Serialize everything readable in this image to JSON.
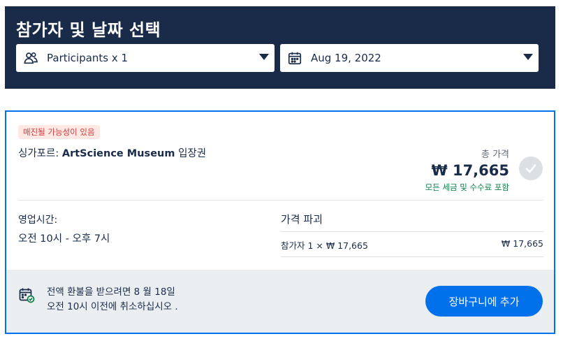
{
  "header": {
    "title": "참가자 및 날짜 선택",
    "participants_label": "Participants x 1",
    "date_label": "Aug 19, 2022"
  },
  "card": {
    "badge": "매진될 가능성이 있음",
    "title_prefix": "싱가포르: ",
    "title_bold": "ArtScience Museum",
    "title_suffix": " 입장권",
    "price_label": "총 가격",
    "price_value": "₩ 17,665",
    "price_note": "모든 세금 및 수수료 포함",
    "hours_label": "영업시간:",
    "hours_value": "오전 10시 - 오후 7시",
    "breakdown_title": "가격 파괴",
    "breakdown_item": "참가자 1 × ₩ 17,665",
    "breakdown_amount": "₩ 17,665",
    "refund_line1": "전액 환불을 받으려면 8 월 18일",
    "refund_line2": "오전 10시 이전에 취소하십시오 .",
    "add_button": "장바구니에 추가"
  },
  "colors": {
    "header_bg": "#1a2b49",
    "accent": "#0071eb",
    "badge_text": "#d13c3c",
    "note_green": "#0a7d47"
  },
  "icons": {
    "participants": "participants-icon",
    "date": "calendar-icon",
    "check": "check-icon",
    "refund": "calendar-check-icon"
  }
}
